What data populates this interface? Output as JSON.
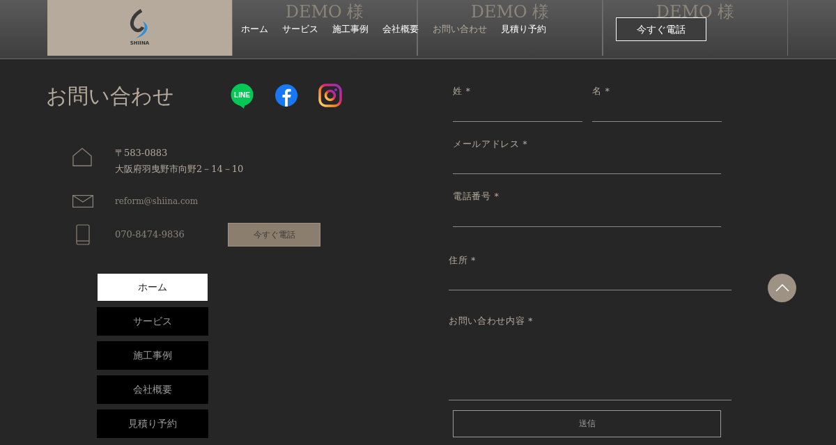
{
  "header": {
    "logo_text": "SHIINA",
    "banners": [
      "DEMO 様",
      "DEMO 様",
      "DEMO 様"
    ],
    "nav": [
      {
        "label": "ホーム",
        "selected": false
      },
      {
        "label": "サービス",
        "selected": false
      },
      {
        "label": "施工事例",
        "selected": false
      },
      {
        "label": "会社概要",
        "selected": false
      },
      {
        "label": "お問い合わせ",
        "selected": true
      },
      {
        "label": "見積り予約",
        "selected": false
      }
    ],
    "call_button": "今すぐ電話"
  },
  "contact": {
    "title": "お問い合わせ",
    "line_label": "LINE",
    "postal": "〒583-0883",
    "address": "大阪府羽曳野市向野2－14－10",
    "email": "reform@shiina.com",
    "phone": "070-8474-9836",
    "call_button": "今すぐ電話"
  },
  "side_menu": [
    {
      "label": "ホーム",
      "selected": true
    },
    {
      "label": "サービス",
      "selected": false
    },
    {
      "label": "施工事例",
      "selected": false
    },
    {
      "label": "会社概要",
      "selected": false
    },
    {
      "label": "見積り予約",
      "selected": false
    }
  ],
  "form": {
    "fields": [
      {
        "label": "姓 *",
        "kind": "half"
      },
      {
        "label": "名 *",
        "kind": "half"
      },
      {
        "label": "メールアドレス *",
        "kind": "line"
      },
      {
        "label": "電話番号 *",
        "kind": "line"
      },
      {
        "label": "住所 *",
        "kind": "wide"
      },
      {
        "label": "お問い合わせ内容 *",
        "kind": "area"
      }
    ],
    "submit": "送信"
  }
}
